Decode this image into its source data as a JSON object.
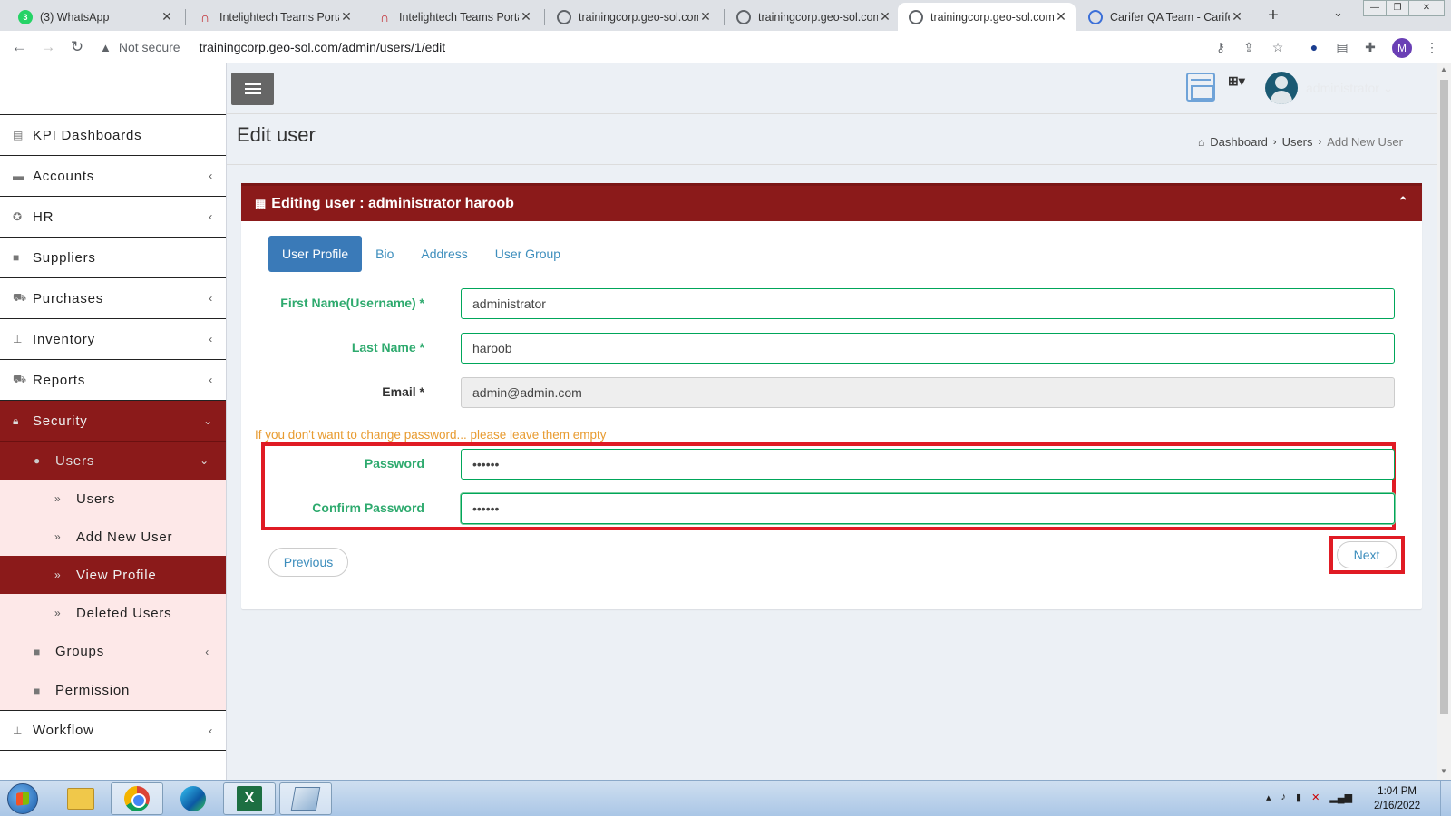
{
  "browser": {
    "tabs": [
      {
        "title": "(3) WhatsApp",
        "favicon": "whatsapp-icon",
        "color": "#25d366",
        "badge": "3"
      },
      {
        "title": "Intelightech Teams Portal",
        "favicon": "headset-icon",
        "color": "#c0262d"
      },
      {
        "title": "Intelightech Teams Portal",
        "favicon": "headset-icon",
        "color": "#c0262d"
      },
      {
        "title": "trainingcorp.geo-sol.com",
        "favicon": "globe-icon",
        "color": "#5f6368"
      },
      {
        "title": "trainingcorp.geo-sol.com",
        "favicon": "globe-icon",
        "color": "#5f6368"
      },
      {
        "title": "trainingcorp.geo-sol.com",
        "favicon": "globe-icon",
        "color": "#5f6368",
        "active": true
      },
      {
        "title": "Carifer QA Team - Carifer",
        "favicon": "power-icon",
        "color": "#3b6fd8"
      }
    ],
    "security_label": "Not secure",
    "url": "trainingcorp.geo-sol.com/admin/users/1/edit",
    "profile_initial": "M"
  },
  "sidebar": {
    "items": [
      {
        "label": "KPI Dashboards",
        "icon": "dashboard-icon"
      },
      {
        "label": "Accounts",
        "icon": "money-icon",
        "has_children": true
      },
      {
        "label": "HR",
        "icon": "award-icon",
        "has_children": true
      },
      {
        "label": "Suppliers",
        "icon": "truck-icon"
      },
      {
        "label": "Purchases",
        "icon": "cart-icon",
        "has_children": true
      },
      {
        "label": "Inventory",
        "icon": "sitemap-icon",
        "has_children": true
      },
      {
        "label": "Reports",
        "icon": "cart-icon",
        "has_children": true
      },
      {
        "label": "Security",
        "icon": "lock-icon",
        "has_children": true,
        "expanded": true
      }
    ],
    "security_children": {
      "users": {
        "label": "Users",
        "icon": "user-icon"
      },
      "users_children": [
        "Users",
        "Add New User",
        "View Profile",
        "Deleted Users"
      ],
      "active_child": "View Profile",
      "groups": {
        "label": "Groups",
        "icon": "group-icon"
      },
      "permission": {
        "label": "Permission",
        "icon": "key-icon"
      }
    },
    "workflow": {
      "label": "Workflow",
      "icon": "sitemap-icon"
    }
  },
  "header": {
    "username": "administrator"
  },
  "page": {
    "title": "Edit user",
    "breadcrumb": [
      "Dashboard",
      "Users",
      "Add New User"
    ]
  },
  "box": {
    "title_prefix": "Editing user :",
    "title_name": "administrator haroob",
    "tabs": [
      "User Profile",
      "Bio",
      "Address",
      "User Group"
    ],
    "active_tab": "User Profile"
  },
  "form": {
    "first_name": {
      "label": "First Name(Username) *",
      "value": "administrator"
    },
    "last_name": {
      "label": "Last Name *",
      "value": "haroob"
    },
    "email": {
      "label": "Email *",
      "value": "admin@admin.com"
    },
    "password_note": "If you don't want to change password... please leave them empty",
    "password": {
      "label": "Password",
      "value": "••••••"
    },
    "confirm_password": {
      "label": "Confirm Password",
      "value": "••••••"
    },
    "previous_label": "Previous",
    "next_label": "Next"
  },
  "colors": {
    "brand_red": "#8b1a1a",
    "tab_blue": "#3a7ab8",
    "label_green": "#2eaa6e",
    "note_orange": "#e89b30",
    "highlight_red": "#e01b24"
  },
  "taskbar": {
    "time": "1:04 PM",
    "date": "2/16/2022"
  }
}
